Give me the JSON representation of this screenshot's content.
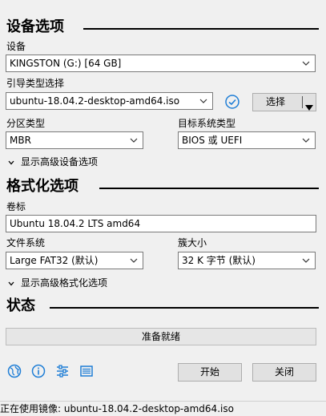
{
  "device_section": {
    "title": "设备选项",
    "device_label": "设备",
    "device_value": "KINGSTON (G:) [64 GB]",
    "boot_label": "引导类型选择",
    "boot_value": "ubuntu-18.04.2-desktop-amd64.iso",
    "select_button": "选择",
    "partition_label": "分区类型",
    "partition_value": "MBR",
    "target_label": "目标系统类型",
    "target_value": "BIOS 或 UEFI",
    "advanced_toggle": "显示高级设备选项"
  },
  "format_section": {
    "title": "格式化选项",
    "volume_label": "卷标",
    "volume_value": "Ubuntu 18.04.2 LTS amd64",
    "fs_label": "文件系统",
    "fs_value": "Large FAT32 (默认)",
    "cluster_label": "簇大小",
    "cluster_value": "32 K 字节 (默认)",
    "advanced_toggle": "显示高级格式化选项"
  },
  "status_section": {
    "title": "状态",
    "progress_text": "准备就绪",
    "progress": 0
  },
  "actions": {
    "start": "开始",
    "close": "关闭"
  },
  "statusbar": {
    "text": "正在使用镜像: ubuntu-18.04.2-desktop-amd64.iso"
  },
  "colors": {
    "accent": "#1f7ed6",
    "rule": "#000000"
  },
  "icons": [
    "globe-icon",
    "info-icon",
    "settings-sliders-icon",
    "log-icon",
    "check-circle-icon"
  ]
}
